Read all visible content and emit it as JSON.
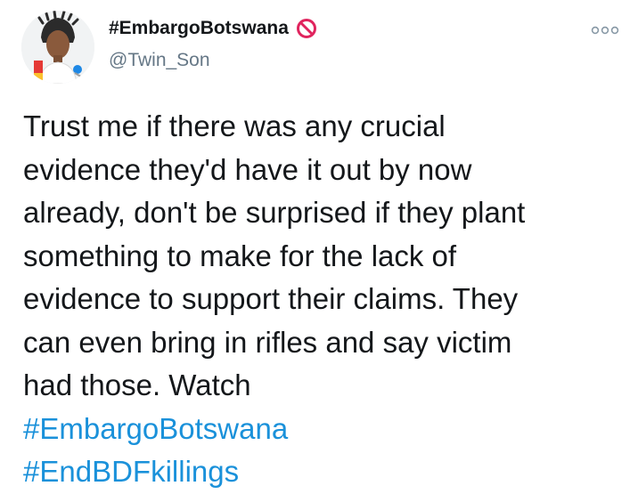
{
  "tweet": {
    "display_name": "#EmbargoBotswana",
    "handle": "@Twin_Son",
    "body_lines": [
      "Trust me if there was any crucial",
      "evidence they'd have it out by now",
      "already, don't be surprised if they plant",
      "something to make for the lack of",
      "evidence to support their claims. They",
      "can even bring in rifles and say victim",
      "had those. Watch"
    ],
    "hashtags": [
      "#EmbargoBotswana",
      "#EndBDFkillings"
    ],
    "icons": {
      "name_badge": "prohibited-icon",
      "menu": "more-options-icon",
      "avatar": "avatar"
    },
    "colors": {
      "hashtag": "#1a91da",
      "handle": "#657786",
      "badge": "#e0245e"
    }
  }
}
